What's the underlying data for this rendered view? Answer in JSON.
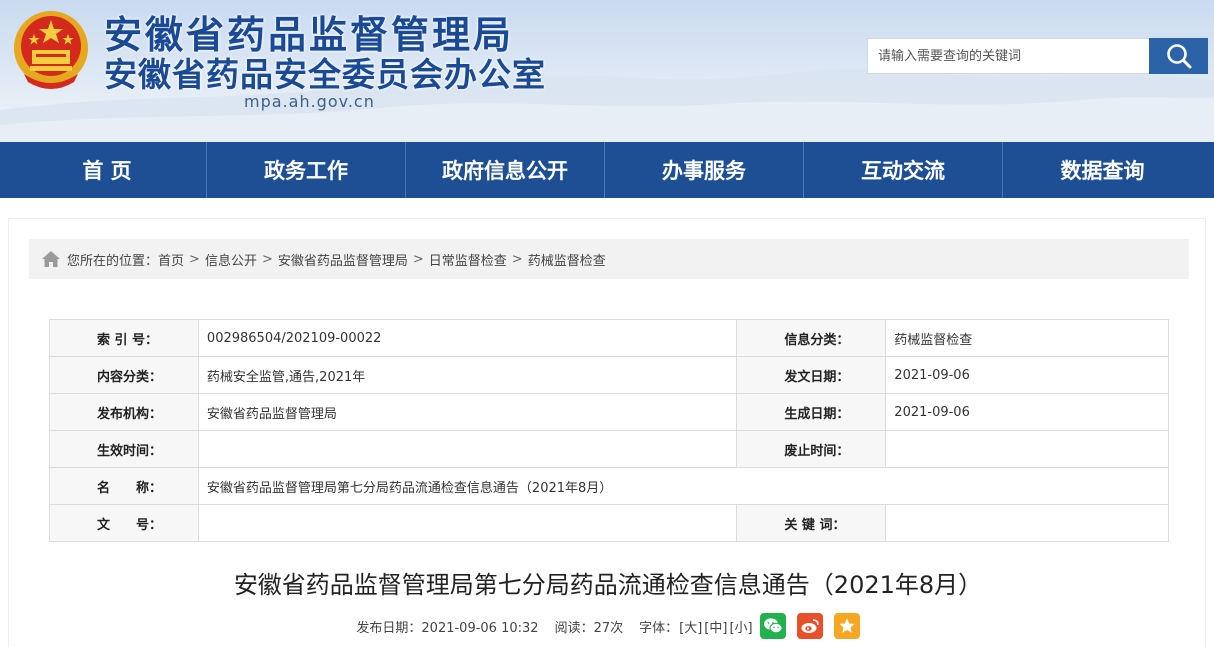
{
  "header": {
    "title_main": "安徽省药品监督管理局",
    "title_sub": "安徽省药品安全委员会办公室",
    "domain": "mpa.ah.gov.cn",
    "search_placeholder": "请输入需要查询的关键词"
  },
  "nav": [
    "首 页",
    "政务工作",
    "政府信息公开",
    "办事服务",
    "互动交流",
    "数据查询"
  ],
  "breadcrumb": {
    "prefix": "您所在的位置：",
    "items": [
      "首页",
      "信息公开",
      "安徽省药品监督管理局",
      "日常监督检查",
      "药械监督检查"
    ],
    "separator": ">"
  },
  "meta": {
    "index_label": "索 引 号：",
    "index_value": "002986504/202109-00022",
    "category_label": "信息分类：",
    "category_value": "药械监督检查",
    "content_label": "内容分类：",
    "content_value": "药械安全监管,通告,2021年",
    "pubdate_label": "发文日期：",
    "pubdate_value": "2021-09-06",
    "org_label": "发布机构：",
    "org_value": "安徽省药品监督管理局",
    "gendate_label": "生成日期：",
    "gendate_value": "2021-09-06",
    "effective_label": "生效时间：",
    "effective_value": "",
    "expire_label": "废止时间：",
    "expire_value": "",
    "name_label": "名　　称：",
    "name_value": "安徽省药品监督管理局第七分局药品流通检查信息通告（2021年8月）",
    "docno_label": "文　　号：",
    "docno_value": "",
    "keywords_label": "关 键 词：",
    "keywords_value": ""
  },
  "article": {
    "title": "安徽省药品监督管理局第七分局药品流通检查信息通告（2021年8月）",
    "published": "发布日期：2021-09-06 10:32",
    "views": "阅读：27次",
    "font_label": "字体：",
    "font_large": "[大]",
    "font_medium": "[中]",
    "font_small": "[小]"
  },
  "icons": {
    "search": "search-icon",
    "home": "home-icon",
    "wechat": "wechat-icon",
    "weibo": "weibo-icon",
    "favorite": "star-icon"
  },
  "colors": {
    "nav_bg": "#1e4f94",
    "title_blue": "#1a4a96",
    "search_btn": "#2c63a8"
  }
}
